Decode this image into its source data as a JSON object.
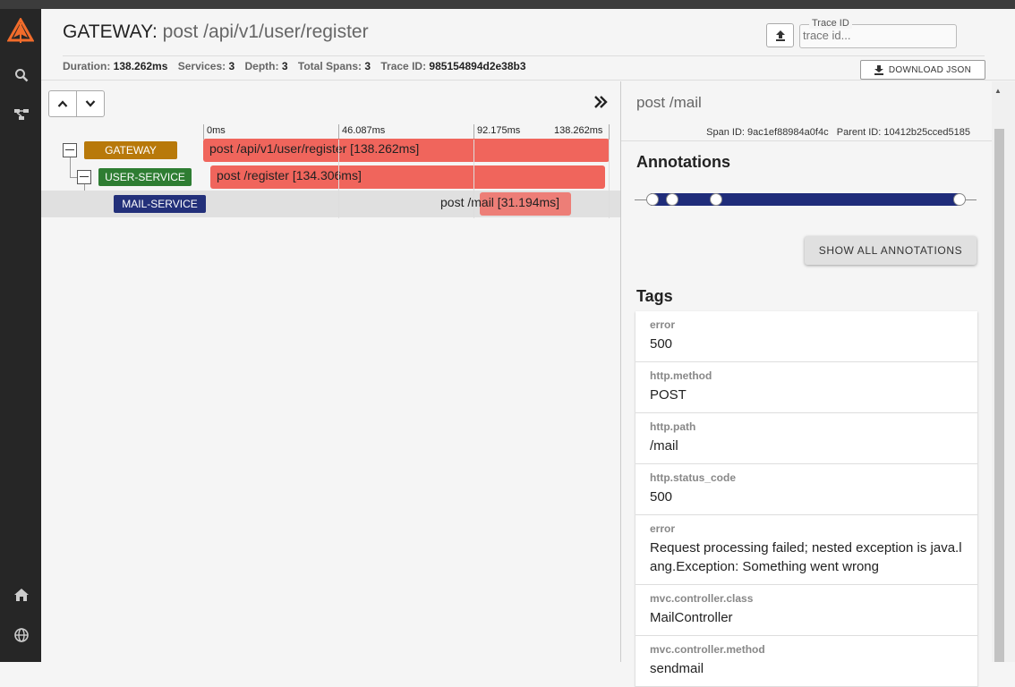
{
  "header": {
    "service": "GATEWAY",
    "separator": ":",
    "span_name": "post /api/v1/user/register",
    "stats": {
      "duration_label": "Duration:",
      "duration": "138.262ms",
      "services_label": "Services:",
      "services": "3",
      "depth_label": "Depth:",
      "depth": "3",
      "spans_label": "Total Spans:",
      "spans": "3",
      "traceid_label": "Trace ID:",
      "traceid": "985154894d2e38b3"
    },
    "trace_id_legend": "Trace ID",
    "trace_id_placeholder": "trace id...",
    "download_label": "DOWNLOAD JSON"
  },
  "timeline": {
    "ticks": [
      "0ms",
      "46.087ms",
      "92.175ms",
      "138.262ms"
    ],
    "rows": [
      {
        "service": "GATEWAY",
        "color": "#b8790a",
        "label": "post /api/v1/user/register [138.262ms]"
      },
      {
        "service": "USER-SERVICE",
        "color": "#2e7d32",
        "label": "post /register [134.306ms]"
      },
      {
        "service": "MAIL-SERVICE",
        "color": "#23307a",
        "label": "post /mail [31.194ms]"
      }
    ]
  },
  "detail": {
    "title": "post /mail",
    "span_id_label": "Span ID:",
    "span_id": "9ac1ef88984a0f4c",
    "parent_id_label": "Parent ID:",
    "parent_id": "10412b25cced5185",
    "annotations_heading": "Annotations",
    "show_all_label": "SHOW ALL ANNOTATIONS",
    "tags_heading": "Tags",
    "tags": [
      {
        "key": "error",
        "value": "500"
      },
      {
        "key": "http.method",
        "value": "POST"
      },
      {
        "key": "http.path",
        "value": "/mail"
      },
      {
        "key": "http.status_code",
        "value": "500"
      },
      {
        "key": "error",
        "value": "Request processing failed; nested exception is java.lang.Exception: Something went wrong"
      },
      {
        "key": "mvc.controller.class",
        "value": "MailController"
      },
      {
        "key": "mvc.controller.method",
        "value": "sendmail"
      }
    ]
  },
  "colors": {
    "sidebar": "#262626",
    "bar": "#f0655c",
    "annotation_bar": "#1f2c7a"
  },
  "icons": [
    "zipkin-logo-icon",
    "search-icon",
    "dependencies-icon",
    "home-icon",
    "globe-icon",
    "upload-icon",
    "download-icon",
    "chevron-up-icon",
    "chevron-down-icon",
    "double-chevron-right-icon"
  ]
}
